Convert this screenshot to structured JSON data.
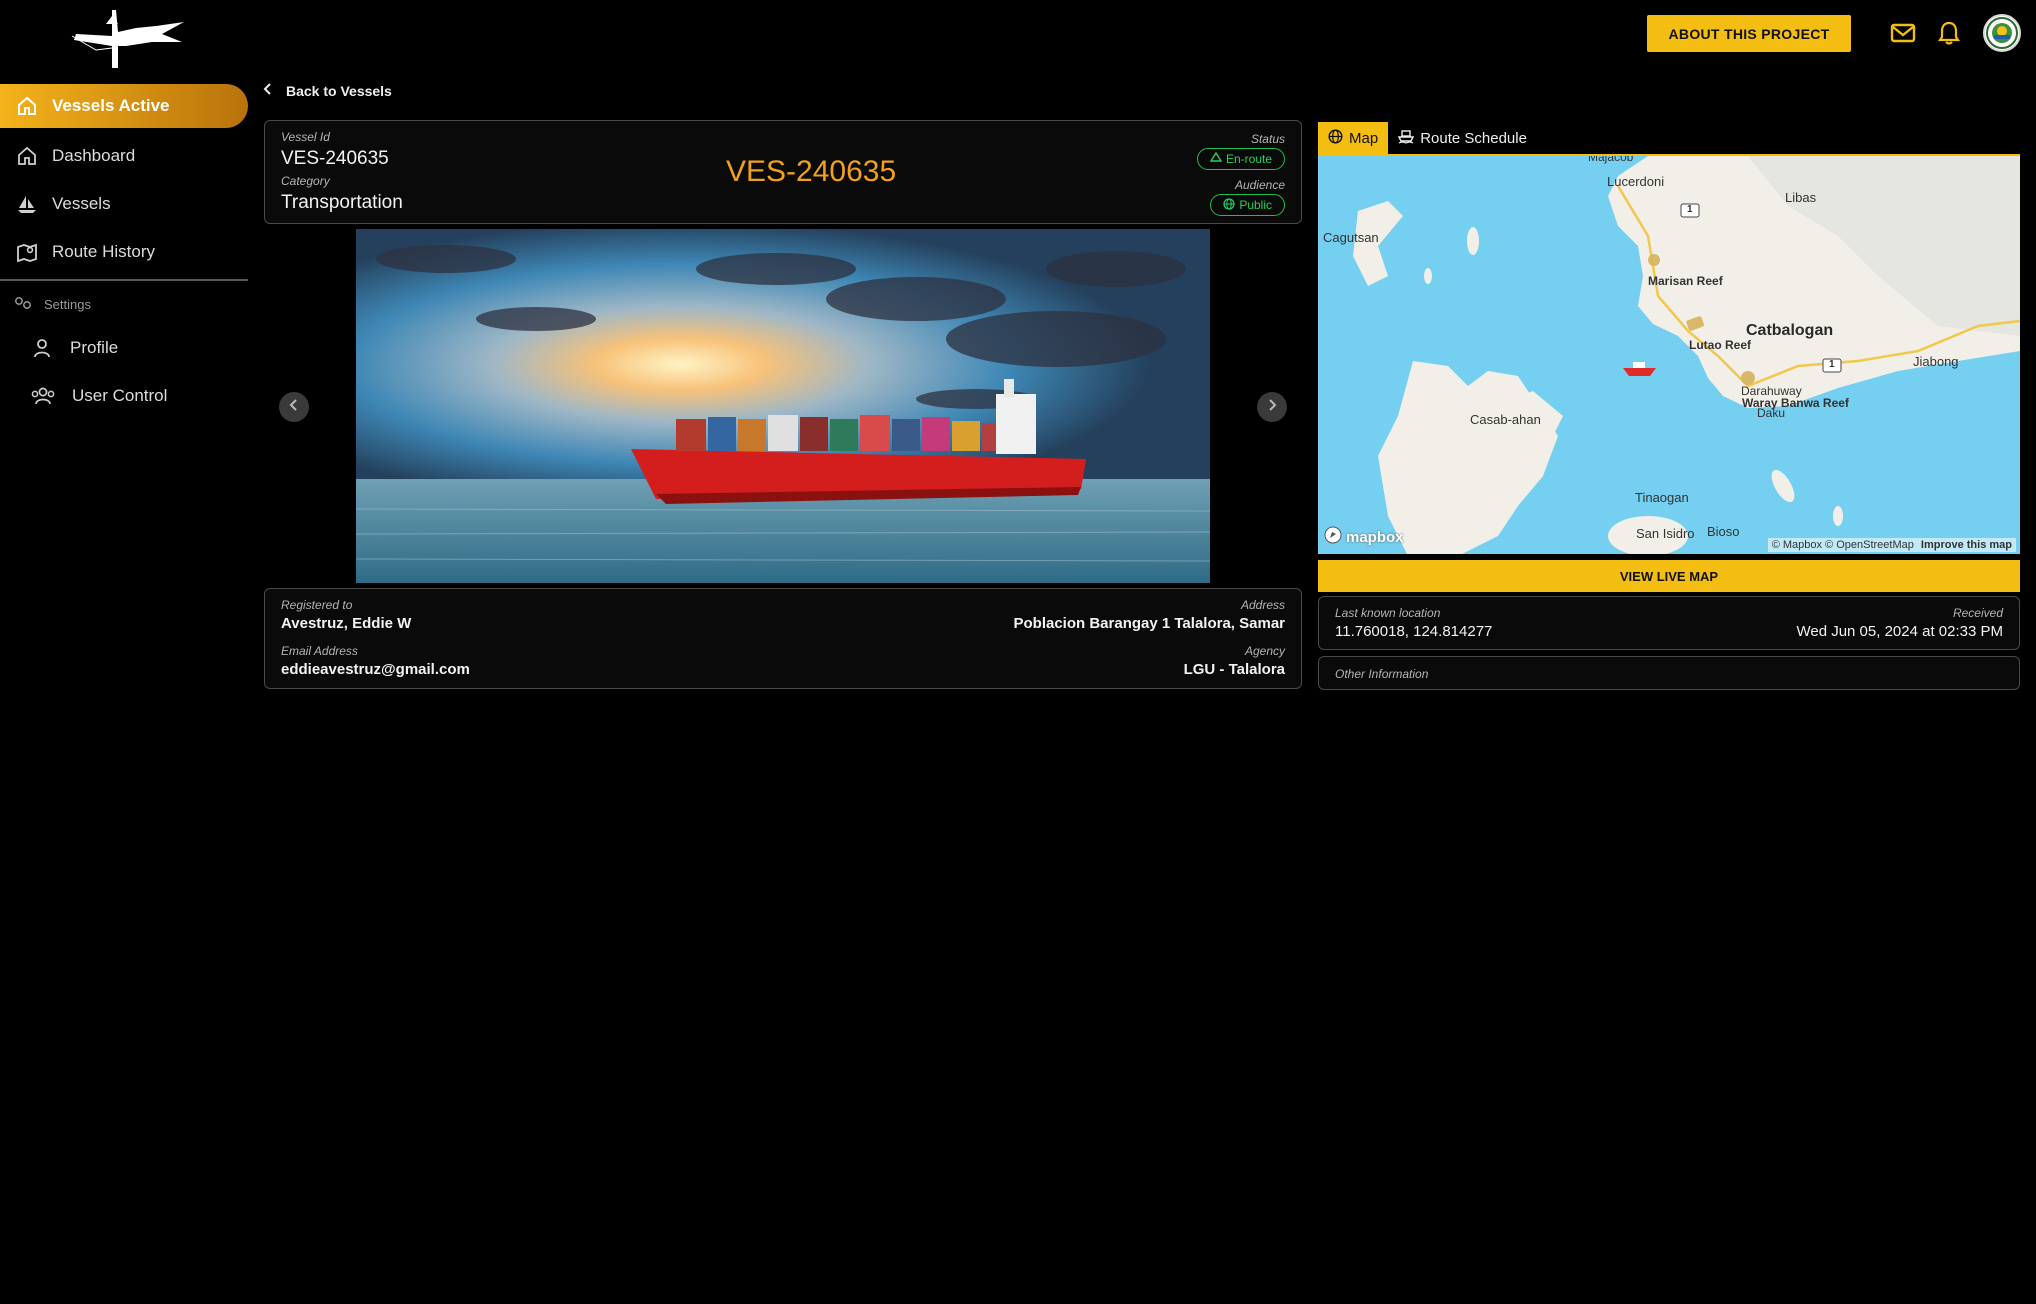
{
  "header": {
    "about_label": "ABOUT THIS PROJECT"
  },
  "sidebar": {
    "items": [
      {
        "label": "Vessels Active",
        "icon": "home-icon"
      },
      {
        "label": "Dashboard",
        "icon": "home-icon"
      },
      {
        "label": "Vessels",
        "icon": "sailboat-icon"
      },
      {
        "label": "Route History",
        "icon": "map-icon"
      }
    ],
    "settings_label": "Settings",
    "sub_items": [
      {
        "label": "Profile",
        "icon": "user-icon"
      },
      {
        "label": "User Control",
        "icon": "users-icon"
      }
    ]
  },
  "back_label": "Back to Vessels",
  "vessel": {
    "id_label": "Vessel Id",
    "id": "VES-240635",
    "category_label": "Category",
    "category": "Transportation",
    "title": "VES-240635",
    "status_label": "Status",
    "status": "En-route",
    "audience_label": "Audience",
    "audience": "Public"
  },
  "owner": {
    "registered_label": "Registered to",
    "registered": "Avestruz, Eddie W",
    "email_label": "Email Address",
    "email": "eddieavestruz@gmail.com",
    "address_label": "Address",
    "address": "Poblacion Barangay 1 Talalora, Samar",
    "agency_label": "Agency",
    "agency": "LGU - Talalora"
  },
  "tabs": {
    "map": "Map",
    "route_schedule": "Route Schedule"
  },
  "map": {
    "labels": {
      "majacob": "Majacob",
      "lucerdoni": "Lucerdoni",
      "libas": "Libas",
      "cagutsan": "Cagutsan",
      "marisan_reef": "Marisan Reef",
      "lutao_reef": "Lutao Reef",
      "catbalogan": "Catbalogan",
      "jiabong": "Jiabong",
      "darahuway": "Darahuway",
      "waray_banwa_reef": "Waray Banwa Reef",
      "daku": "Daku",
      "casab_ahan": "Casab-ahan",
      "tinaogan": "Tinaogan",
      "san_isidro": "San Isidro",
      "bioso": "Bioso",
      "road_1": "1"
    },
    "brand": "mapbox",
    "attribution": "© Mapbox © OpenStreetMap",
    "improve": "Improve this map"
  },
  "live_map_label": "VIEW LIVE MAP",
  "location": {
    "last_known_label": "Last known location",
    "coords": "11.760018, 124.814277",
    "received_label": "Received",
    "received": "Wed Jun 05, 2024 at 02:33 PM"
  },
  "other_info_label": "Other Information",
  "colors": {
    "accent": "#f4bd12",
    "title_orange": "#f2a11a",
    "status_green": "#2ad15d"
  }
}
